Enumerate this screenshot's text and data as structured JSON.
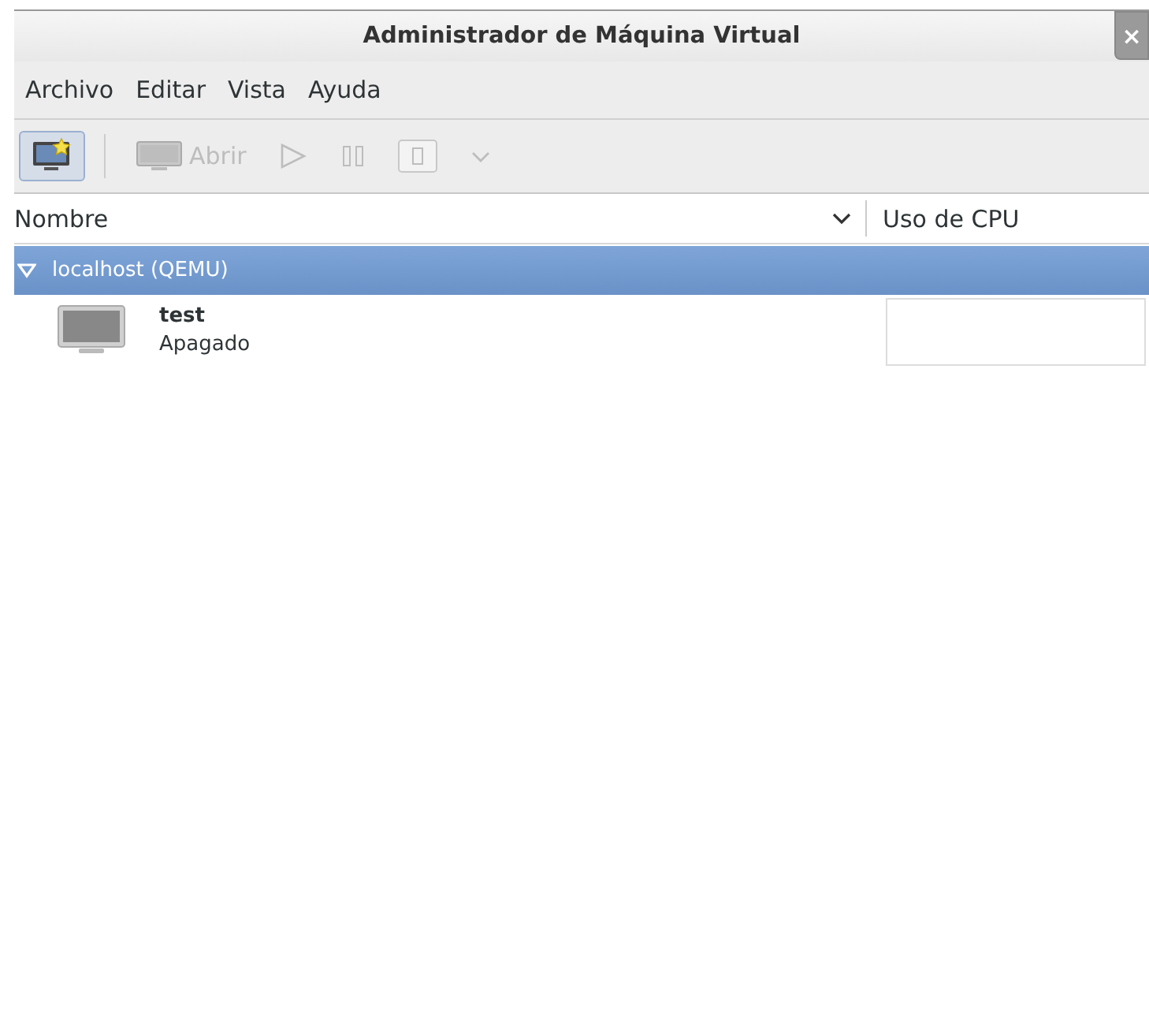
{
  "window": {
    "title": "Administrador de Máquina Virtual",
    "close": "×"
  },
  "menu": [
    {
      "label": "Archivo"
    },
    {
      "label": "Editar"
    },
    {
      "label": "Vista"
    },
    {
      "label": "Ayuda"
    }
  ],
  "toolbar": [
    {
      "kind": "new",
      "disabled": false,
      "selected": true
    },
    {
      "kind": "separator"
    },
    {
      "kind": "open",
      "label": "Abrir",
      "disabled": true,
      "selected": false
    },
    {
      "kind": "run",
      "disabled": true,
      "selected": false
    },
    {
      "kind": "pause",
      "disabled": true,
      "selected": false
    },
    {
      "kind": "stop",
      "disabled": true,
      "selected": false
    },
    {
      "kind": "menu",
      "disabled": true,
      "selected": false
    }
  ],
  "columns": [
    {
      "label": "Nombre",
      "sort": true
    },
    {
      "label": "Uso de CPU",
      "sort": false
    }
  ],
  "groups": [
    {
      "label": "localhost (QEMU)",
      "expanded": true,
      "selected": true,
      "children": [
        {
          "name": "test",
          "status": "Apagado"
        }
      ]
    }
  ]
}
